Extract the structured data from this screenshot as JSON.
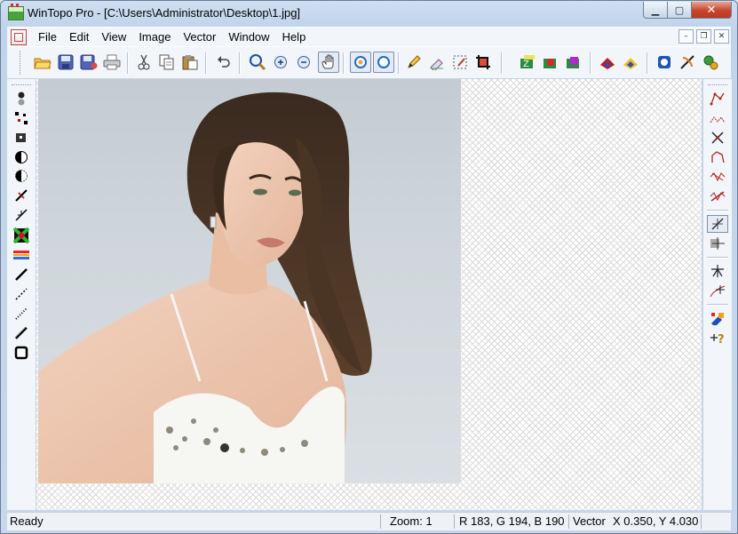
{
  "window": {
    "title": "WinTopo Pro - [C:\\Users\\Administrator\\Desktop\\1.jpg]"
  },
  "menu": [
    "File",
    "Edit",
    "View",
    "Image",
    "Vector",
    "Window",
    "Help"
  ],
  "status": {
    "state": "Ready",
    "zoom": "Zoom: 1",
    "rgb": "R 183, G 194, B 190",
    "mode": "Vector",
    "coords": "X 0.350, Y 4.030"
  },
  "toolbar_icons": [
    "open-icon",
    "save-icon",
    "save-as-icon",
    "print-icon",
    "cut-icon",
    "copy-icon",
    "paste-icon",
    "undo-icon",
    "zoom-icon",
    "zoom-in-icon",
    "zoom-out-icon",
    "pan-hand-icon",
    "view-raster-icon",
    "view-vector-icon",
    "pencil-icon",
    "eraser-icon",
    "select-area-icon",
    "crop-icon",
    "layer-z-icon",
    "layer-red-icon",
    "layer-purple-icon",
    "fill-red-icon",
    "fill-yellow-icon",
    "blue-diamond-icon",
    "vectorize-icon",
    "settings-icon"
  ],
  "colors": {
    "accent": "#3a6ea5",
    "close": "#c6462c",
    "canvas_bg": "#ffffff"
  }
}
